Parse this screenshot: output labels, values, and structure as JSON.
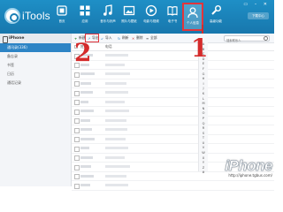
{
  "app": {
    "name": "iTools"
  },
  "nav": [
    {
      "label": "首页",
      "icon": "home-icon"
    },
    {
      "label": "应用",
      "icon": "apps-icon"
    },
    {
      "label": "音乐与铃声",
      "icon": "music-icon"
    },
    {
      "label": "照片与壁纸",
      "icon": "photo-icon"
    },
    {
      "label": "电影与视频",
      "icon": "video-icon"
    },
    {
      "label": "电子书",
      "icon": "book-icon"
    },
    {
      "label": "个人信息",
      "icon": "person-icon"
    },
    {
      "label": "高级功能",
      "icon": "wrench-icon"
    }
  ],
  "top_right": {
    "download_label": "下载中心"
  },
  "sidebar": {
    "device_name": "iPhone",
    "items": [
      {
        "label": "通讯录(336)"
      },
      {
        "label": "备忘录"
      },
      {
        "label": "书签"
      },
      {
        "label": "日历"
      },
      {
        "label": "通话记录"
      }
    ]
  },
  "toolbar": {
    "new_label": "新建",
    "export_label": "导出",
    "import_label": "导入",
    "refresh_label": "刷新",
    "delete_label": "删除",
    "all_label": "全部",
    "search_placeholder": "搜索联系人"
  },
  "table": {
    "col_name": "姓名",
    "col_phone": "电话"
  },
  "alphabet": [
    "A",
    "B",
    "C",
    "D",
    "E",
    "F",
    "G",
    "H",
    "I",
    "J",
    "K",
    "L",
    "M",
    "N",
    "O",
    "P",
    "Q",
    "R",
    "S",
    "T",
    "U",
    "V",
    "W",
    "X",
    "Y",
    "Z",
    "#"
  ],
  "annotations": {
    "one": "1",
    "two": "2"
  },
  "watermark": {
    "brand": "iPhone",
    "url": "http://iphone.tgbus.com/"
  },
  "colors": {
    "topbar": "#1e8fc6",
    "accent_red": "#e3343b",
    "selected": "#2d84c5"
  }
}
